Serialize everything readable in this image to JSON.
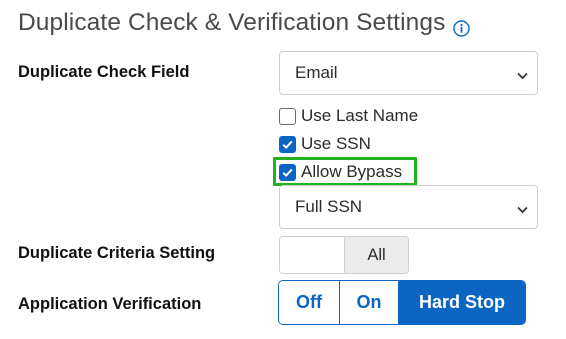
{
  "section": {
    "title": "Duplicate Check & Verification Settings",
    "info_icon": "info-circle-icon"
  },
  "duplicate_check_field": {
    "label": "Duplicate Check Field",
    "selected": "Email"
  },
  "options": {
    "use_last_name": {
      "label": "Use Last Name",
      "checked": false
    },
    "use_ssn": {
      "label": "Use SSN",
      "checked": true
    },
    "allow_bypass": {
      "label": "Allow Bypass",
      "checked": true,
      "highlighted": true
    }
  },
  "ssn_mode": {
    "selected": "Full SSN"
  },
  "duplicate_criteria": {
    "label": "Duplicate Criteria Setting",
    "selected": "All"
  },
  "application_verification": {
    "label": "Application Verification",
    "options": [
      "Off",
      "On",
      "Hard Stop"
    ],
    "selected": "Hard Stop"
  },
  "colors": {
    "accent": "#0b66c3",
    "highlight": "#22b11f",
    "title": "#4a4a4a"
  }
}
